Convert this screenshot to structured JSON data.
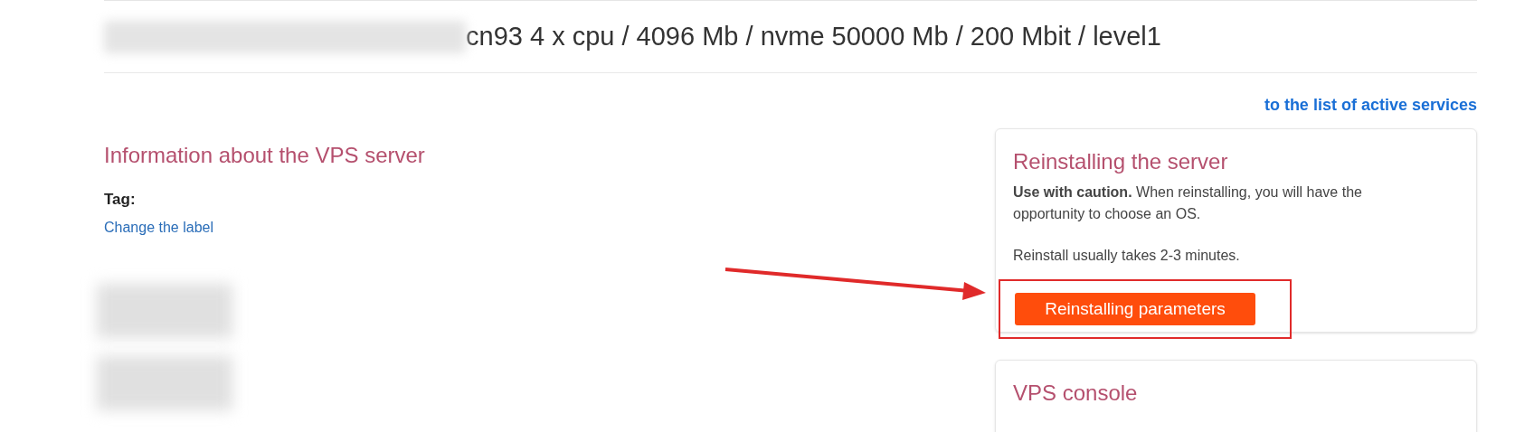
{
  "page_title": "cn93 4 x cpu / 4096 Mb / nvme 50000 Mb / 200 Mbit / level1",
  "back_link": "to the list of active services",
  "info": {
    "heading": "Information about the VPS server",
    "tag_label": "Tag:",
    "change_label_link": "Change the label"
  },
  "reinstall_card": {
    "title": "Reinstalling the server",
    "caution": "**Use with caution.** When reinstalling, you will have the opportunity to choose an OS.",
    "note": "Reinstall usually takes 2-3 minutes.",
    "button": "Reinstalling parameters"
  },
  "console_card": {
    "title": "VPS console"
  }
}
